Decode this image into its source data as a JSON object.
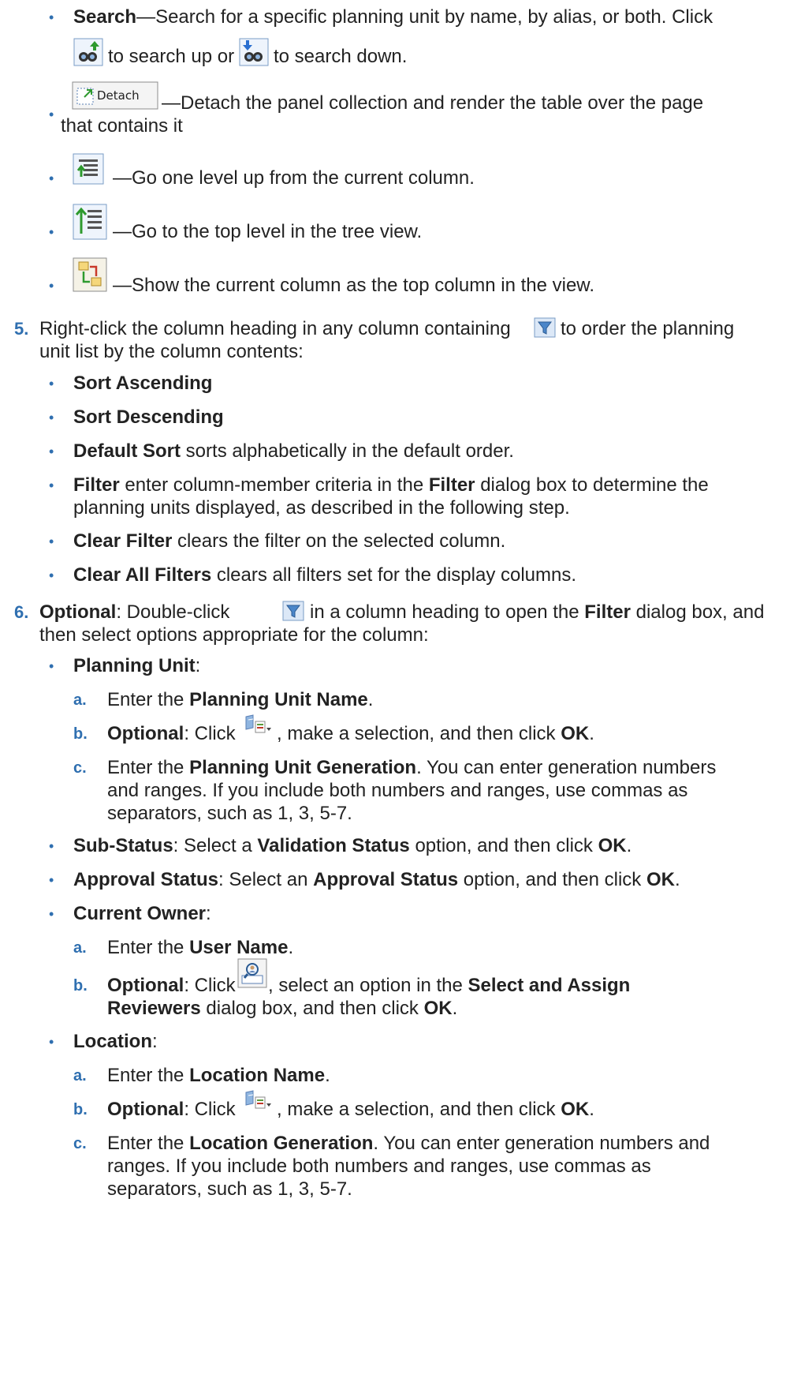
{
  "colors": {
    "accent": "#2f6fb0",
    "text": "#222222",
    "icon_border": "#7a9cc6",
    "icon_bg": "#eef4fc"
  },
  "icons": {
    "search_up": "binoculars-up-icon",
    "search_down": "binoculars-down-icon",
    "detach": "detach-icon",
    "go_up": "go-up-level-icon",
    "go_top": "go-top-level-icon",
    "show_top": "show-as-top-icon",
    "filter": "filter-funnel-icon",
    "hierarchy_dropdown": "hierarchy-dropdown-icon",
    "user_search": "user-search-icon"
  },
  "toolbar_items": {
    "search_bold": "Search",
    "search_text": "—Search for a specific planning unit by name, by alias, or both. Click",
    "search_up_text": "to search up or",
    "search_down_text": "to search down.",
    "detach_label": "Detach",
    "detach_text": "—Detach the panel collection and render the table over the page",
    "detach_text_2": "that contains it",
    "go_up_text": "—Go one level up from the current column.",
    "go_top_text": "—Go to the top level in the tree view.",
    "show_top_text": "—Show the current column as the top column in the view."
  },
  "step5": {
    "number": "5.",
    "text_a": "Right-click the column heading in any column containing",
    "text_b": "to order the planning",
    "text_c": "unit list by the column contents:",
    "items": {
      "sort_asc": "Sort Ascending",
      "sort_desc": "Sort Descending",
      "default_sort_bold": "Default Sort",
      "default_sort_text": " sorts alphabetically in the default order.",
      "filter_bold": "Filter",
      "filter_text_a": " enter column-member criteria in the ",
      "filter_bold_2": "Filter",
      "filter_text_b": " dialog box to determine the",
      "filter_text_c": "planning units displayed, as described in the following step.",
      "clear_filter_bold": "Clear Filter",
      "clear_filter_text": " clears the filter on the selected column.",
      "clear_all_bold": "Clear All Filters",
      "clear_all_text": " clears all filters set for the display columns."
    }
  },
  "step6": {
    "number": "6.",
    "optional": "Optional",
    "text_a": ": Double-click",
    "text_b": "in a column heading to open the ",
    "filter_bold": "Filter",
    "text_c": " dialog box, and",
    "text_d": "then select options appropriate for the column:",
    "planning_unit": {
      "label": "Planning Unit",
      "colon": ":",
      "a_letter": "a.",
      "a_text": "Enter the ",
      "a_bold": "Planning Unit Name",
      "b_letter": "b.",
      "b_optional": "Optional",
      "b_text_a": ": Click",
      "b_text_b": ", make a selection, and then click ",
      "ok": "OK",
      "c_letter": "c.",
      "c_text": "Enter the ",
      "c_bold": "Planning Unit Generation",
      "c_text_b": ". You can enter generation numbers",
      "c_line2": "and ranges. If you include both numbers and ranges, use commas as",
      "c_line3": "separators, such as 1, 3, 5-7."
    },
    "sub_status": {
      "label": "Sub-Status",
      "text_a": ": Select a ",
      "bold": "Validation Status",
      "text_b": " option, and then click ",
      "ok": "OK"
    },
    "approval_status": {
      "label": "Approval Status",
      "text_a": ": Select an ",
      "bold": "Approval Status",
      "text_b": " option, and then click ",
      "ok": "OK"
    },
    "current_owner": {
      "label": "Current Owner",
      "colon": ":",
      "a_letter": "a.",
      "a_text": "Enter the ",
      "a_bold": "User Name",
      "b_letter": "b.",
      "b_optional": "Optional",
      "b_text_a": ": Click",
      "b_text_b": ", select an option in the ",
      "b_bold": "Select and Assign",
      "b_bold_2": "Reviewers",
      "b_text_c": " dialog box, and then click ",
      "ok": "OK"
    },
    "location": {
      "label": "Location",
      "colon": ":",
      "a_letter": "a.",
      "a_text": "Enter the ",
      "a_bold": "Location Name",
      "b_letter": "b.",
      "b_optional": "Optional",
      "b_text_a": ": Click",
      "b_text_b": ", make a selection, and then click ",
      "ok": "OK",
      "c_letter": "c.",
      "c_text": "Enter the ",
      "c_bold": "Location Generation",
      "c_text_b": ". You can enter generation numbers and",
      "c_line2": "ranges. If you include both numbers and ranges, use commas as",
      "c_line3": "separators, such as 1, 3, 5-7."
    }
  },
  "period": "."
}
